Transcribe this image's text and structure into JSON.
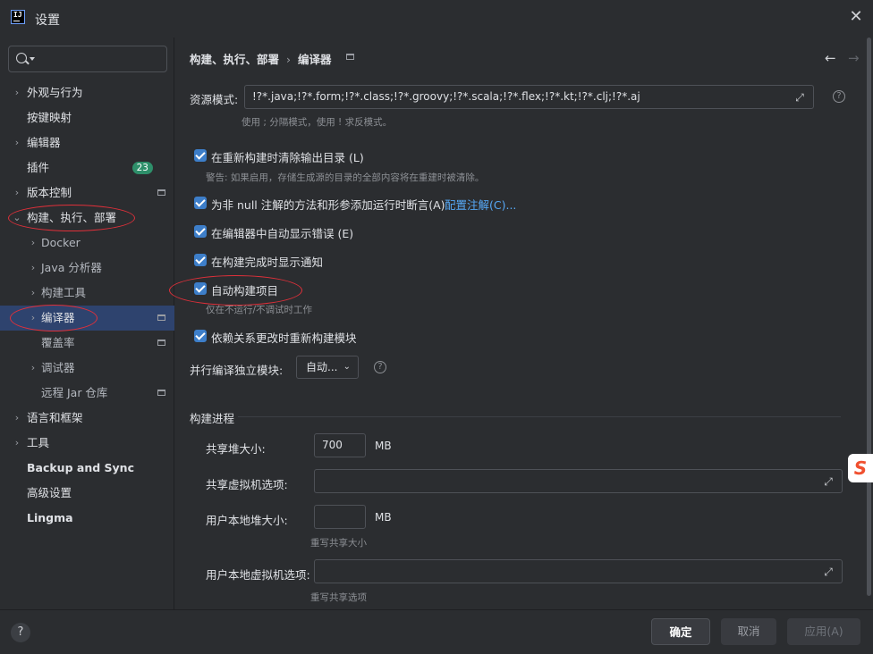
{
  "window": {
    "title": "设置",
    "logo_text": "IJ"
  },
  "search": {
    "placeholder": ""
  },
  "sidebar": {
    "items": [
      {
        "label": "外观与行为",
        "chevron": "›"
      },
      {
        "label": "按键映射"
      },
      {
        "label": "编辑器",
        "chevron": "›"
      },
      {
        "label": "插件",
        "badge": "23"
      },
      {
        "label": "版本控制",
        "chevron": "›"
      },
      {
        "label": "构建、执行、部署",
        "chevron": "⌄"
      },
      {
        "label": "Docker",
        "chevron": "›"
      },
      {
        "label": "Java 分析器",
        "chevron": "›"
      },
      {
        "label": "构建工具",
        "chevron": "›"
      },
      {
        "label": "编译器",
        "chevron": "›"
      },
      {
        "label": "覆盖率"
      },
      {
        "label": "调试器",
        "chevron": "›"
      },
      {
        "label": "远程 Jar 仓库"
      },
      {
        "label": "语言和框架",
        "chevron": "›"
      },
      {
        "label": "工具",
        "chevron": "›"
      },
      {
        "label": "Backup and Sync"
      },
      {
        "label": "高级设置"
      },
      {
        "label": "Lingma"
      }
    ],
    "help": "?"
  },
  "main": {
    "breadcrumb": {
      "parent": "构建、执行、部署",
      "sep": "›",
      "current": "编译器"
    },
    "nav": {
      "back": "←",
      "forward": "→"
    },
    "resource_patterns": {
      "label": "资源模式:",
      "value": "!?*.java;!?*.form;!?*.class;!?*.groovy;!?*.scala;!?*.flex;!?*.kt;!?*.clj;!?*.aj",
      "hint": "使用 ; 分隔模式，使用 ! 求反模式。"
    },
    "checkboxes": {
      "clear_output": {
        "label": "在重新构建时清除输出目录 (L)",
        "hint": "警告: 如果启用，存储生成源的目录的全部内容将在重建时被清除。"
      },
      "not_null_assert": {
        "label": "为非 null 注解的方法和形参添加运行时断言(A)",
        "link": "配置注解(C)..."
      },
      "auto_show_errors": {
        "label": "在编辑器中自动显示错误 (E)"
      },
      "notify_on_complete": {
        "label": "在构建完成时显示通知"
      },
      "auto_build": {
        "label": "自动构建项目",
        "hint": "仅在不运行/不调试时工作"
      },
      "rebuild_dependents": {
        "label": "依赖关系更改时重新构建模块"
      }
    },
    "parallel": {
      "label": "并行编译独立模块:",
      "value": "自动...",
      "caret": "⌄"
    },
    "build_process": {
      "title": "构建进程",
      "shared_heap": {
        "label": "共享堆大小:",
        "value": "700",
        "unit": "MB"
      },
      "shared_vm": {
        "label": "共享虚拟机选项:",
        "value": ""
      },
      "user_heap": {
        "label": "用户本地堆大小:",
        "value": "",
        "unit": "MB",
        "hint": "重写共享大小"
      },
      "user_vm": {
        "label": "用户本地虚拟机选项:",
        "value": "",
        "hint": "重写共享选项"
      }
    }
  },
  "footer": {
    "ok": "确定",
    "cancel": "取消",
    "apply": "应用(A)"
  },
  "side_logo": "S",
  "colors": {
    "accent": "#3d7ec9",
    "selection": "#2e436e",
    "annotation": "#e0303a",
    "link": "#56a8f5",
    "badge": "#2e8f6a"
  }
}
